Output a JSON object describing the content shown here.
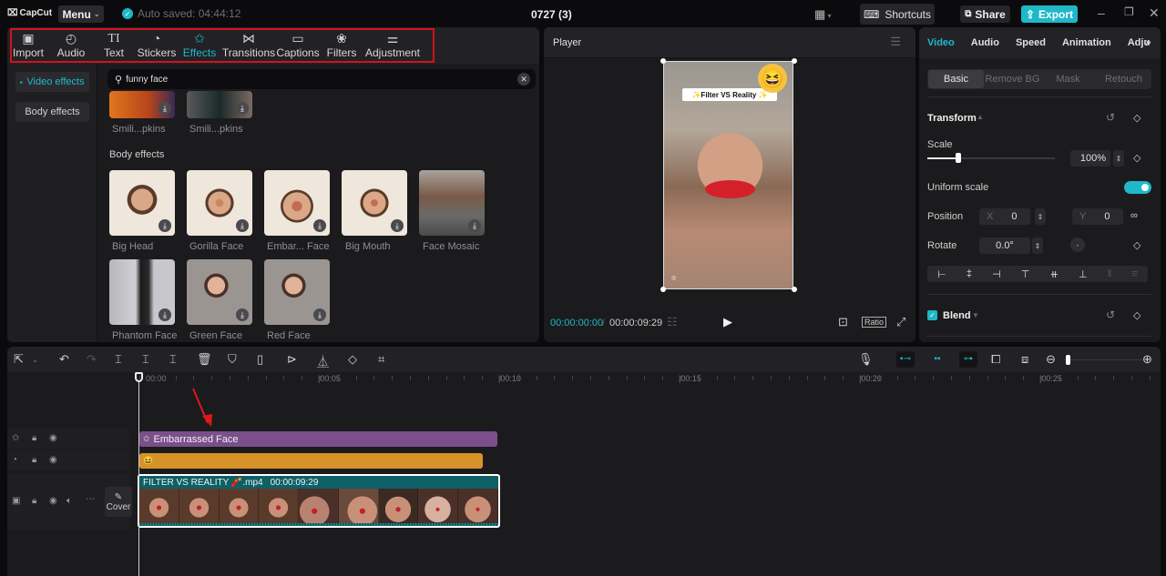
{
  "titlebar": {
    "app_name": "CapCut",
    "menu_label": "Menu",
    "autosave_text": "Auto saved: 04:44:12",
    "project_title": "0727 (3)",
    "shortcuts_label": "Shortcuts",
    "share_label": "Share",
    "export_label": "Export",
    "accent_color": "#1fb8c8"
  },
  "media_toolbar": {
    "tabs": [
      {
        "label": "Import",
        "icon": "import-icon"
      },
      {
        "label": "Audio",
        "icon": "audio-icon"
      },
      {
        "label": "Text",
        "icon": "text-icon"
      },
      {
        "label": "Stickers",
        "icon": "stickers-icon"
      },
      {
        "label": "Effects",
        "icon": "effects-icon",
        "active": true
      },
      {
        "label": "Transitions",
        "icon": "transitions-icon"
      },
      {
        "label": "Captions",
        "icon": "captions-icon"
      },
      {
        "label": "Filters",
        "icon": "filters-icon"
      },
      {
        "label": "Adjustment",
        "icon": "adjustment-icon"
      }
    ]
  },
  "effects_nav": {
    "items": [
      {
        "label": "Video effects",
        "active": true
      },
      {
        "label": "Body effects"
      }
    ]
  },
  "search": {
    "value": "funny face"
  },
  "effects": {
    "top_items": [
      {
        "label": "Smili...pkins"
      },
      {
        "label": "Smili...pkins"
      }
    ],
    "body_section_title": "Body effects",
    "body_items": [
      {
        "label": "Big Head"
      },
      {
        "label": "Gorilla Face"
      },
      {
        "label": "Embar... Face"
      },
      {
        "label": "Big Mouth"
      },
      {
        "label": "Face Mosaic"
      },
      {
        "label": "Phantom Face"
      },
      {
        "label": "Green Face"
      },
      {
        "label": "Red Face"
      }
    ]
  },
  "player": {
    "title": "Player",
    "caption_text": "✨Filter VS Reality ✨",
    "current_time": "00:00:00:00",
    "total_time": "00:00:09:29",
    "ratio_label": "Ratio"
  },
  "inspector": {
    "tabs": [
      "Video",
      "Audio",
      "Speed",
      "Animation",
      "Adju"
    ],
    "subtabs": [
      "Basic",
      "Remove BG",
      "Mask",
      "Retouch"
    ],
    "transform_label": "Transform",
    "scale_label": "Scale",
    "scale_value": "100%",
    "scale_fraction": 0.1,
    "uniform_scale_label": "Uniform scale",
    "uniform_scale_on": true,
    "position_label": "Position",
    "position_x_label": "X",
    "position_x": "0",
    "position_y_label": "Y",
    "position_y": "0",
    "rotate_label": "Rotate",
    "rotate_value": "0.0°",
    "blend_label": "Blend",
    "blend_checked": true
  },
  "timeline": {
    "ruler_labels": [
      "00:00",
      "|00:05",
      "|00:10",
      "|00:15",
      "|00:20",
      "|00:25"
    ],
    "effect_clip_label": "Embarrassed Face",
    "effect_clip_color": "#7a4f8a",
    "sticker_clip_color": "#d8922a",
    "video_clip_name": "FILTER VS REALITY 🧨.mp4",
    "video_clip_duration": "00:00:09:29",
    "video_clip_color": "#0e5f66",
    "cover_label": "Cover"
  }
}
